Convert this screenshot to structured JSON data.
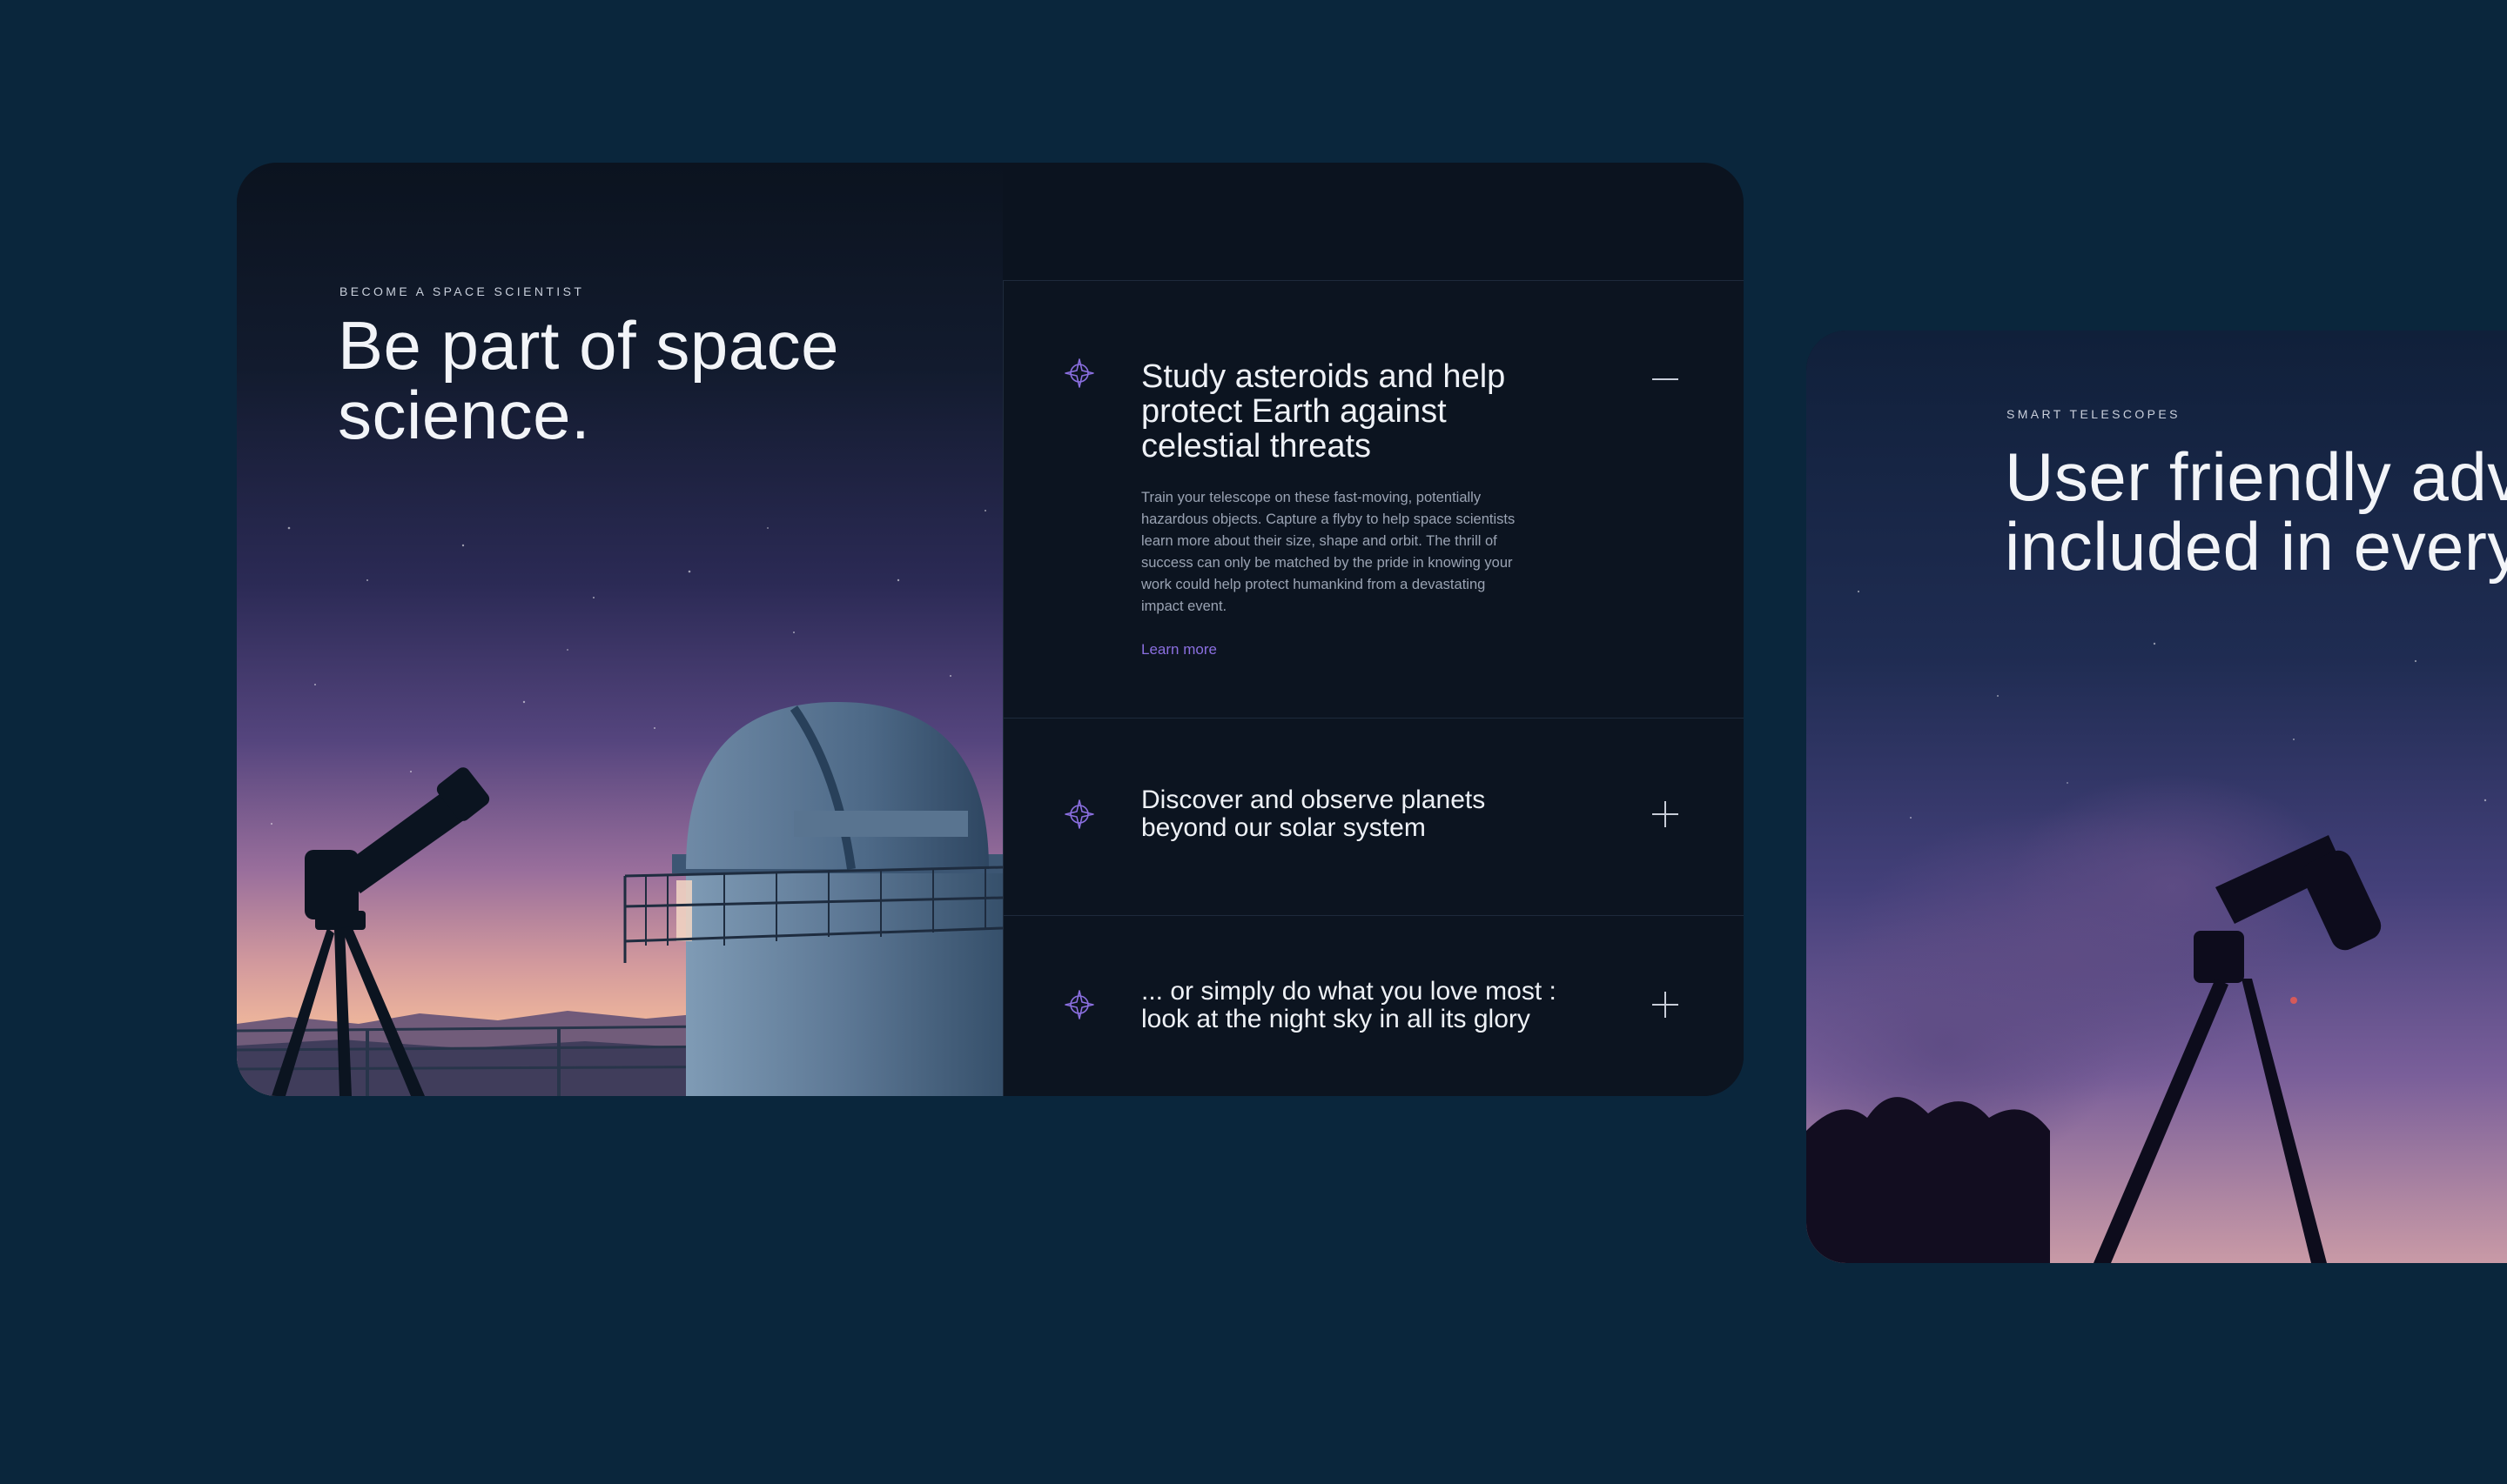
{
  "left_card": {
    "eyebrow": "BECOME A SPACE SCIENTIST",
    "headline_line1": "Be part of space",
    "headline_line2": "science."
  },
  "accordion": [
    {
      "icon": "star-compass-icon",
      "title_lines": [
        "Study asteroids and help",
        "protect Earth against",
        "celestial threats"
      ],
      "expanded": true,
      "toggle": "minus-icon",
      "body_lines": [
        "Train your telescope on these fast-moving, potentially",
        "hazardous objects. Capture a flyby to help space scientists",
        "learn more about their size, shape and orbit. The thrill of",
        "success can only be matched by the pride in knowing your",
        "work could help protect humankind from a devastating",
        "impact event."
      ],
      "link": "Learn more"
    },
    {
      "icon": "star-compass-icon",
      "title_lines": [
        "Discover and observe planets",
        "beyond our solar system"
      ],
      "expanded": false,
      "toggle": "plus-icon"
    },
    {
      "icon": "star-compass-icon",
      "title_lines": [
        "... or simply do what you love most :",
        "look at the night sky in all its glory"
      ],
      "expanded": false,
      "toggle": "plus-icon"
    }
  ],
  "right_card": {
    "eyebrow": "SMART TELESCOPES",
    "headline_line1": "User friendly adv",
    "headline_line2": "included in every"
  },
  "colors": {
    "page_background": "#0a263c",
    "card_background": "#0b131f",
    "accent": "#8b6fe0",
    "text": "#eef1f6",
    "muted": "#9aa3b3"
  }
}
